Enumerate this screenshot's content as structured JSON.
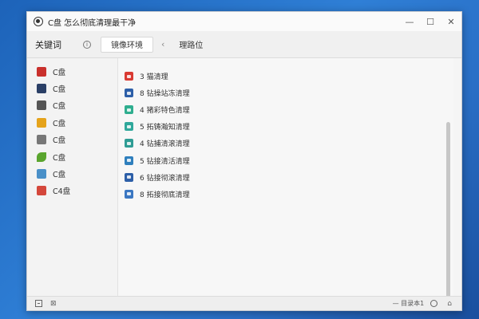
{
  "window": {
    "title": "C盘 怎么彻底清理最干净",
    "minimize": "—",
    "maximize": "☐",
    "close": "✕"
  },
  "toolbar": {
    "keyword_label": "关键词",
    "active_tab": "镜像环境",
    "back": "‹",
    "tab2": "理路位"
  },
  "sidebar": {
    "items": [
      {
        "label": "C盘",
        "icon": "house-icon",
        "color": "#c9302c"
      },
      {
        "label": "C盘",
        "icon": "shield-icon",
        "color": "#2a3f66"
      },
      {
        "label": "C盘",
        "icon": "headphones-icon",
        "color": "#555555"
      },
      {
        "label": "C盘",
        "icon": "calendar-icon",
        "color": "#e5a31b"
      },
      {
        "label": "C盘",
        "icon": "document-icon",
        "color": "#777777"
      },
      {
        "label": "C盘",
        "icon": "leaf-icon",
        "color": "#5aa52e"
      },
      {
        "label": "C盘",
        "icon": "image-icon",
        "color": "#4a90c8"
      },
      {
        "label": "C4盘",
        "icon": "card-icon",
        "color": "#d4473b"
      }
    ]
  },
  "list": {
    "items": [
      {
        "text": "3 猫清理",
        "color": "#d93a32"
      },
      {
        "text": "8 钻操站冻清理",
        "color": "#2d5fa8"
      },
      {
        "text": "4 猪彩特色清理",
        "color": "#2fae8f"
      },
      {
        "text": "5 拓铸瀚知清理",
        "color": "#2fa89b"
      },
      {
        "text": "4 钻捕清滚清理",
        "color": "#2e9c94"
      },
      {
        "text": "5 钻接清活清理",
        "color": "#2f7fbd"
      },
      {
        "text": "6 钻接彻滚清理",
        "color": "#2d5fa8"
      },
      {
        "text": "8 拓接彻底清理",
        "color": "#3b77c2"
      }
    ]
  },
  "status": {
    "text": "— 目录本1",
    "trash": "⊠",
    "home": "⌂"
  }
}
